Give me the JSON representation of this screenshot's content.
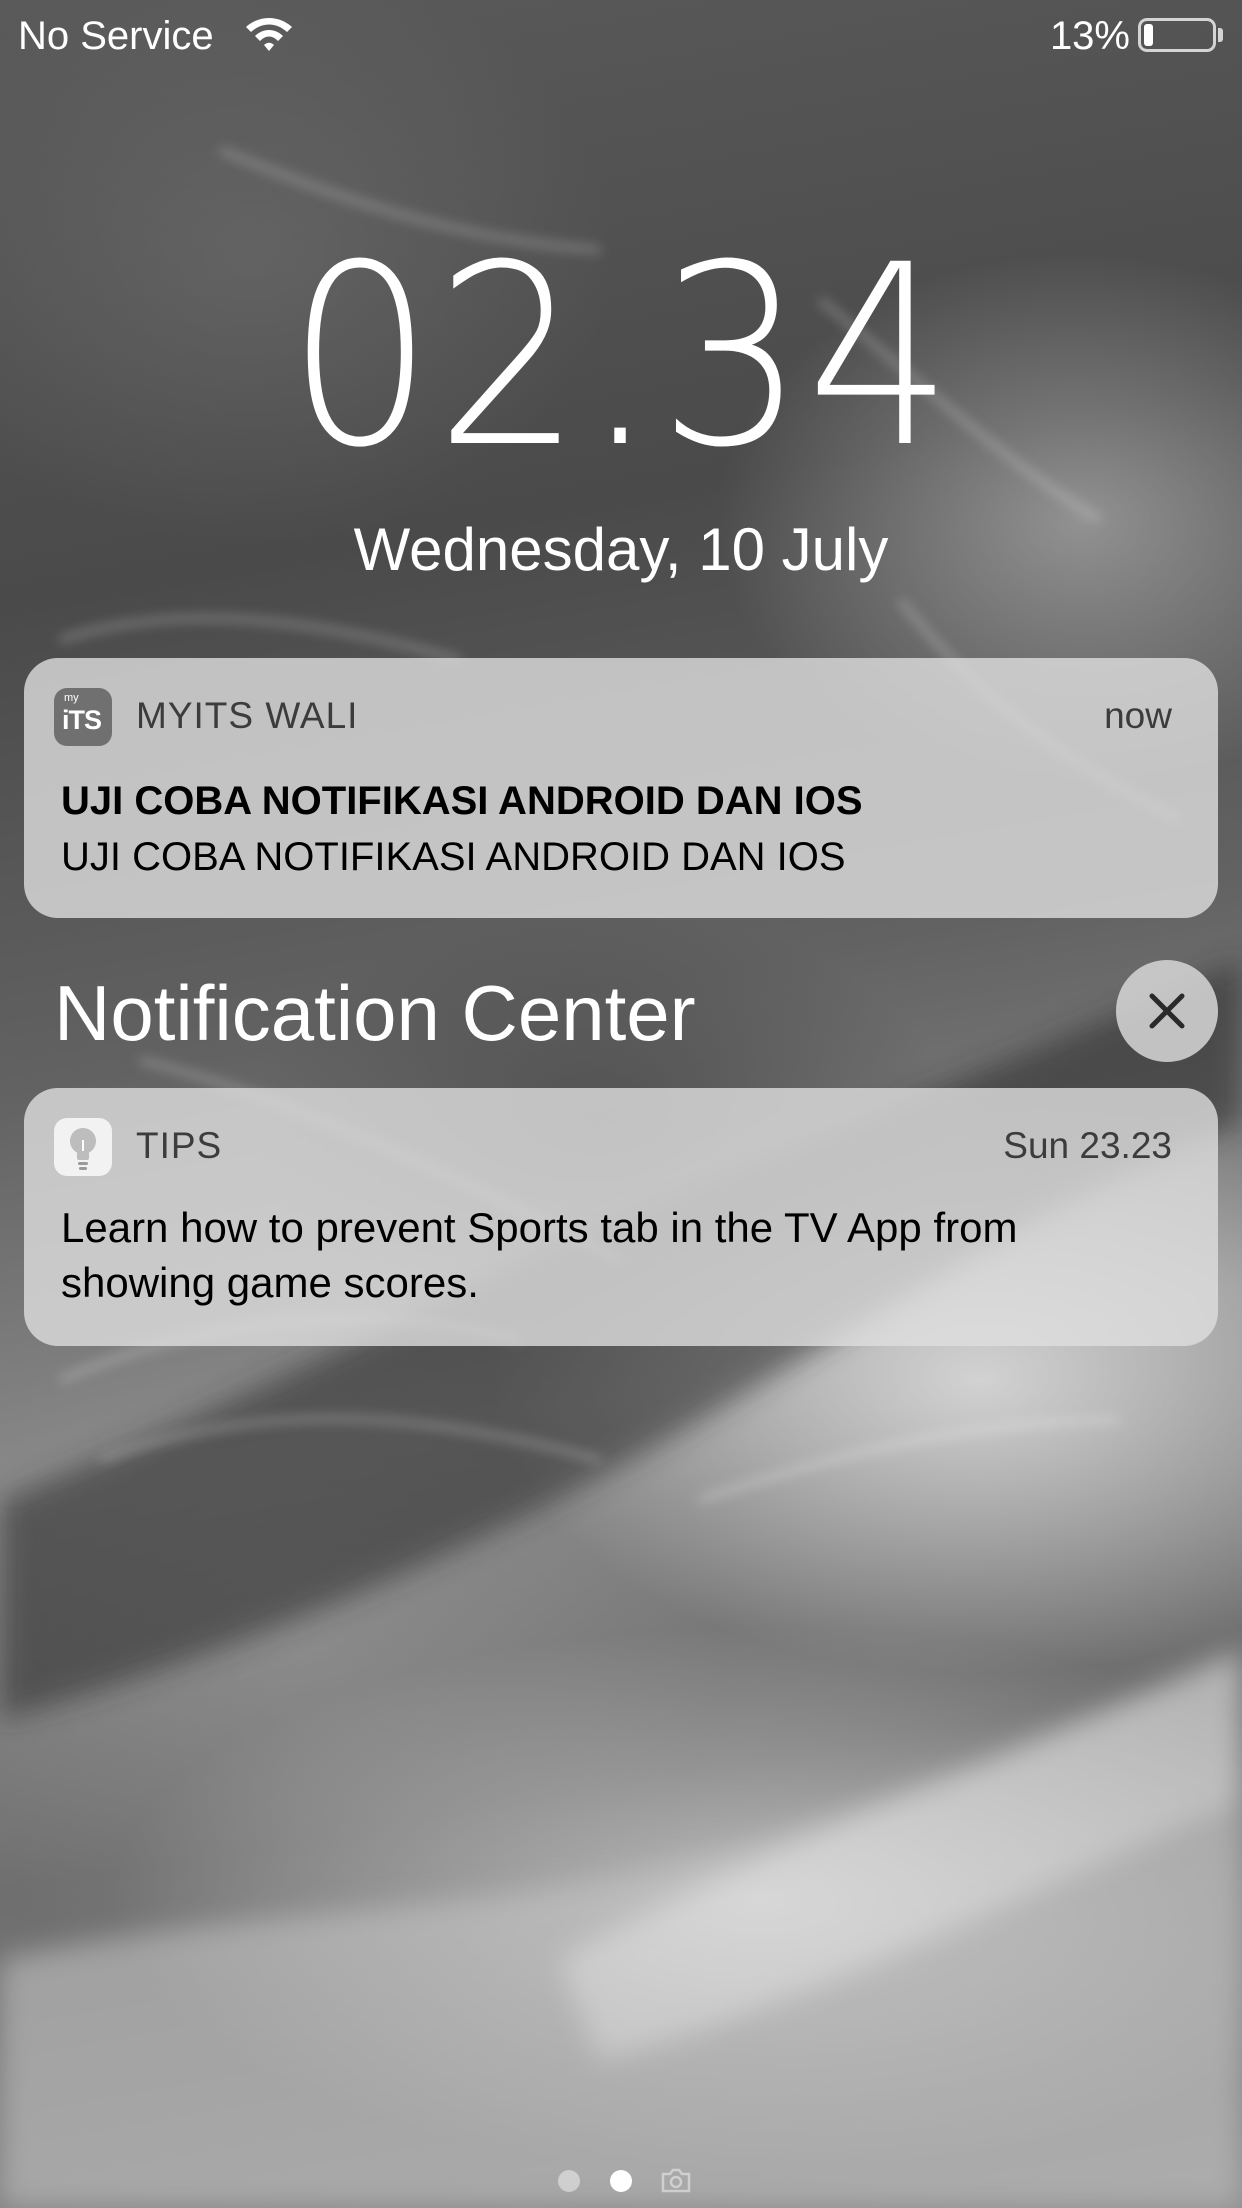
{
  "status_bar": {
    "carrier": "No Service",
    "wifi_icon": "wifi-icon",
    "battery_percent": "13%",
    "battery_level": 0.13,
    "battery_icon": "battery-icon"
  },
  "lock_screen": {
    "time": "02.34",
    "date": "Wednesday, 10 July"
  },
  "notifications": [
    {
      "app_name": "MYITS WALI",
      "app_icon": "myits-app-icon",
      "icon_label_small": "my",
      "icon_label_big": "iTS",
      "time": "now",
      "title": "UJI COBA NOTIFIKASI ANDROID DAN IOS",
      "body": "UJI COBA NOTIFIKASI ANDROID DAN IOS"
    }
  ],
  "notification_center": {
    "title": "Notification Center",
    "clear_icon": "close-icon",
    "items": [
      {
        "app_name": "TIPS",
        "app_icon": "lightbulb-icon",
        "time": "Sun 23.23",
        "body": "Learn how to prevent Sports tab in the TV App from showing game scores."
      }
    ]
  },
  "page_indicator": {
    "count": 2,
    "current": 2,
    "camera_icon": "camera-icon"
  }
}
